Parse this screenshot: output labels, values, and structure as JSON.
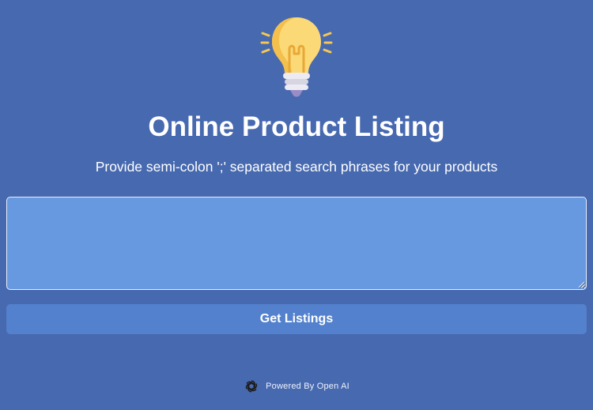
{
  "header": {
    "icon": "lightbulb-icon",
    "title": "Online Product Listing",
    "subtitle": "Provide semi-colon ';' separated search phrases for your products"
  },
  "form": {
    "phrases_value": "",
    "phrases_placeholder": "",
    "submit_label": "Get Listings"
  },
  "footer": {
    "icon": "openai-logo-icon",
    "text": "Powered By Open AI"
  },
  "colors": {
    "background": "#4769b0",
    "textarea_bg": "#6699e0",
    "button_bg": "#5381cd",
    "bulb_glass": "#fcd977",
    "bulb_base": "#e3e0ea"
  }
}
